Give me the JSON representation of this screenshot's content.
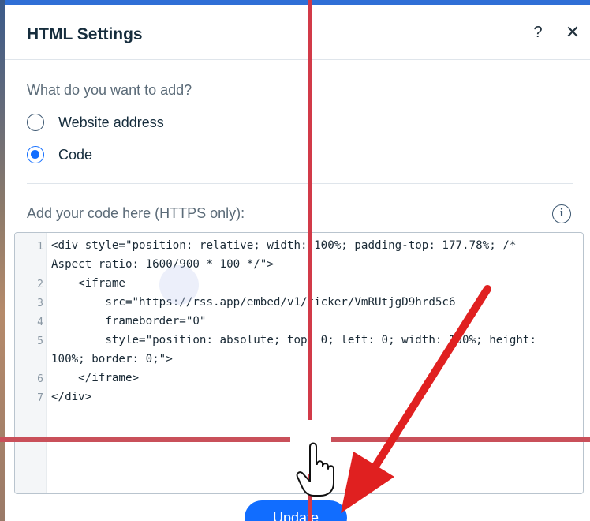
{
  "dialog": {
    "title": "HTML Settings",
    "help_glyph": "?",
    "close_glyph": "✕"
  },
  "source": {
    "question": "What do you want to add?",
    "options": [
      {
        "label": "Website address",
        "selected": false
      },
      {
        "label": "Code",
        "selected": true
      }
    ]
  },
  "code_section": {
    "label": "Add your code here (HTTPS only):",
    "info_glyph": "i",
    "lines": [
      {
        "num": "1",
        "text": "<div style=\"position: relative; width: 100%; padding-top: 177.78%; /*"
      },
      {
        "num": "",
        "text": "Aspect ratio: 1600/900 * 100 */\">"
      },
      {
        "num": "2",
        "text": "    <iframe"
      },
      {
        "num": "3",
        "text": "        src=\"https://rss.app/embed/v1/ticker/VmRUtjgD9hrd5c6"
      },
      {
        "num": "4",
        "text": "        frameborder=\"0\""
      },
      {
        "num": "5",
        "text": "        style=\"position: absolute; top: 0; left: 0; width: 100%; height:"
      },
      {
        "num": "",
        "text": "100%; border: 0;\">"
      },
      {
        "num": "6",
        "text": "    </iframe>"
      },
      {
        "num": "7",
        "text": "</div>"
      }
    ]
  },
  "footer": {
    "update_label": "Update"
  },
  "colors": {
    "accent": "#116dff",
    "guide_red": "#d23a48",
    "arrow_red": "#e02020"
  },
  "icons": {
    "help": "question-mark-icon",
    "close": "close-icon",
    "info": "info-icon",
    "pointer": "hand-pointer-icon",
    "arrow": "red-arrow-annotation"
  }
}
